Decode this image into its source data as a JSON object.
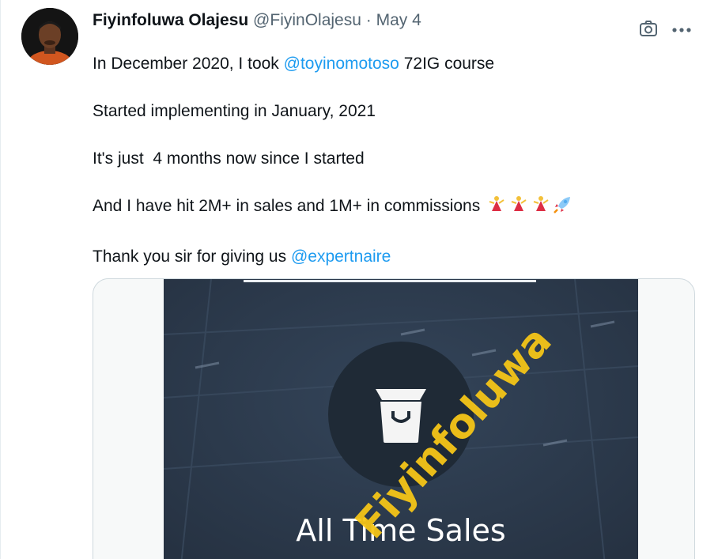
{
  "tweet": {
    "author_name": "Fiyinfoluwa Olajesu",
    "author_handle": "@FiyinOlajesu",
    "separator": "·",
    "timestamp": "May 4",
    "text": {
      "line1_a": "In December 2020, I took ",
      "line1_mention": "@toyinomotoso",
      "line1_b": " 72IG course",
      "line2": "Started implementing in January, 2021",
      "line3": "It's just  4 months now since I started",
      "line4": "And I have hit 2M+ in sales and 1M+ in commissions ",
      "line5_a": "Thank you sir for giving us ",
      "line5_mention": "@expertnaire"
    },
    "emojis": [
      "dancer-icon",
      "dancer-icon",
      "dancer-icon",
      "rocket-icon"
    ],
    "media": {
      "label": "All Time Sales",
      "watermark": "Fiyinfoluwa"
    }
  },
  "colors": {
    "mention": "#1d9bf0",
    "secondary_text": "#536471",
    "watermark": "#f5c518",
    "media_bg": "#2e3a4a"
  },
  "icons": {
    "camera": "camera-icon",
    "more": "more-icon",
    "shopping_bag": "shopping-bag-icon"
  }
}
